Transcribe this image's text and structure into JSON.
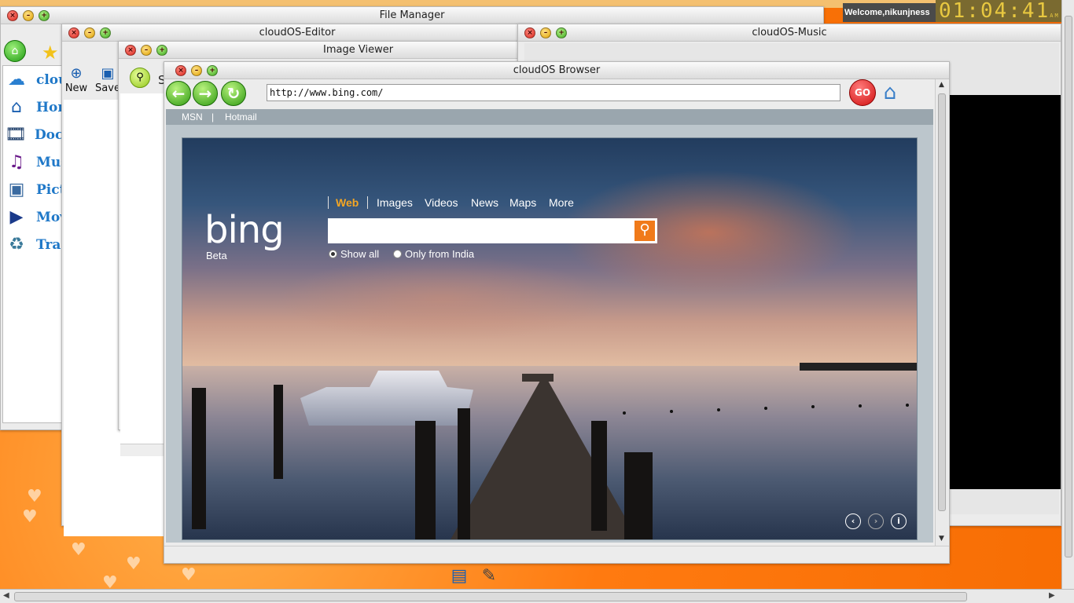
{
  "desktop": {
    "welcome_text": "Welcome,nikunjness",
    "clock": {
      "time": "01:04:41",
      "ampm": "AM"
    }
  },
  "windows": {
    "file_manager": {
      "title": "File Manager",
      "sidebar": [
        {
          "label": "cloudOS",
          "icon": "cloud-icon"
        },
        {
          "label": "Home",
          "icon": "home-icon"
        },
        {
          "label": "Documents",
          "icon": "film-icon"
        },
        {
          "label": "Music",
          "icon": "music-note-icon"
        },
        {
          "label": "Pictures",
          "icon": "picture-icon"
        },
        {
          "label": "Movies",
          "icon": "clapper-icon"
        },
        {
          "label": "Trash",
          "icon": "trash-icon"
        }
      ]
    },
    "editor": {
      "title": "cloudOS-Editor",
      "new_label": "New",
      "save_label": "Save"
    },
    "image_viewer": {
      "title": "Image Viewer",
      "search_label": "S"
    },
    "music": {
      "title": "cloudOS-Music"
    },
    "browser": {
      "title": "cloudOS Browser",
      "url": "http://www.bing.com/",
      "go_label": "GO",
      "links": [
        "MSN",
        "|",
        "Hotmail"
      ],
      "bing": {
        "logo": "bing",
        "beta": "Beta",
        "nav": [
          "Web",
          "Images",
          "Videos",
          "News",
          "Maps",
          "More"
        ],
        "active_nav": "Web",
        "radio_all": "Show all",
        "radio_india": "Only from India",
        "accent_color": "#f5a623"
      }
    }
  }
}
